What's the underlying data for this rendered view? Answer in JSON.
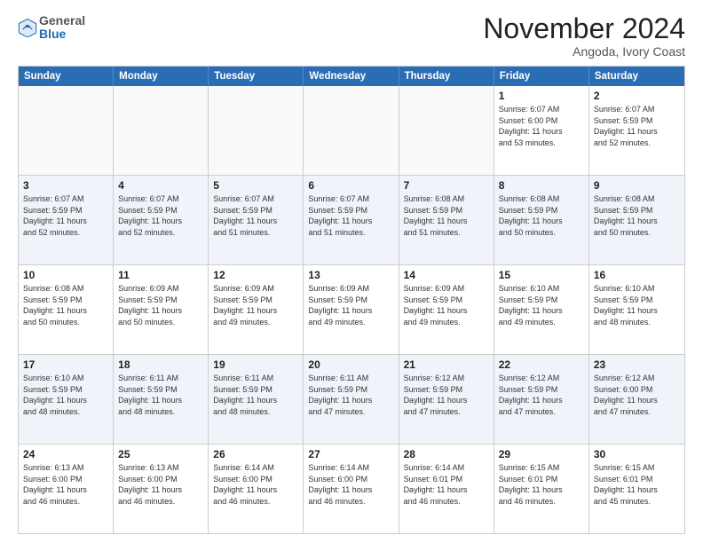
{
  "header": {
    "logo_general": "General",
    "logo_blue": "Blue",
    "month_title": "November 2024",
    "location": "Angoda, Ivory Coast"
  },
  "weekdays": [
    "Sunday",
    "Monday",
    "Tuesday",
    "Wednesday",
    "Thursday",
    "Friday",
    "Saturday"
  ],
  "rows": [
    {
      "alt": false,
      "cells": [
        {
          "empty": true,
          "day": "",
          "info": ""
        },
        {
          "empty": true,
          "day": "",
          "info": ""
        },
        {
          "empty": true,
          "day": "",
          "info": ""
        },
        {
          "empty": true,
          "day": "",
          "info": ""
        },
        {
          "empty": true,
          "day": "",
          "info": ""
        },
        {
          "empty": false,
          "day": "1",
          "info": "Sunrise: 6:07 AM\nSunset: 6:00 PM\nDaylight: 11 hours\nand 53 minutes."
        },
        {
          "empty": false,
          "day": "2",
          "info": "Sunrise: 6:07 AM\nSunset: 5:59 PM\nDaylight: 11 hours\nand 52 minutes."
        }
      ]
    },
    {
      "alt": true,
      "cells": [
        {
          "empty": false,
          "day": "3",
          "info": "Sunrise: 6:07 AM\nSunset: 5:59 PM\nDaylight: 11 hours\nand 52 minutes."
        },
        {
          "empty": false,
          "day": "4",
          "info": "Sunrise: 6:07 AM\nSunset: 5:59 PM\nDaylight: 11 hours\nand 52 minutes."
        },
        {
          "empty": false,
          "day": "5",
          "info": "Sunrise: 6:07 AM\nSunset: 5:59 PM\nDaylight: 11 hours\nand 51 minutes."
        },
        {
          "empty": false,
          "day": "6",
          "info": "Sunrise: 6:07 AM\nSunset: 5:59 PM\nDaylight: 11 hours\nand 51 minutes."
        },
        {
          "empty": false,
          "day": "7",
          "info": "Sunrise: 6:08 AM\nSunset: 5:59 PM\nDaylight: 11 hours\nand 51 minutes."
        },
        {
          "empty": false,
          "day": "8",
          "info": "Sunrise: 6:08 AM\nSunset: 5:59 PM\nDaylight: 11 hours\nand 50 minutes."
        },
        {
          "empty": false,
          "day": "9",
          "info": "Sunrise: 6:08 AM\nSunset: 5:59 PM\nDaylight: 11 hours\nand 50 minutes."
        }
      ]
    },
    {
      "alt": false,
      "cells": [
        {
          "empty": false,
          "day": "10",
          "info": "Sunrise: 6:08 AM\nSunset: 5:59 PM\nDaylight: 11 hours\nand 50 minutes."
        },
        {
          "empty": false,
          "day": "11",
          "info": "Sunrise: 6:09 AM\nSunset: 5:59 PM\nDaylight: 11 hours\nand 50 minutes."
        },
        {
          "empty": false,
          "day": "12",
          "info": "Sunrise: 6:09 AM\nSunset: 5:59 PM\nDaylight: 11 hours\nand 49 minutes."
        },
        {
          "empty": false,
          "day": "13",
          "info": "Sunrise: 6:09 AM\nSunset: 5:59 PM\nDaylight: 11 hours\nand 49 minutes."
        },
        {
          "empty": false,
          "day": "14",
          "info": "Sunrise: 6:09 AM\nSunset: 5:59 PM\nDaylight: 11 hours\nand 49 minutes."
        },
        {
          "empty": false,
          "day": "15",
          "info": "Sunrise: 6:10 AM\nSunset: 5:59 PM\nDaylight: 11 hours\nand 49 minutes."
        },
        {
          "empty": false,
          "day": "16",
          "info": "Sunrise: 6:10 AM\nSunset: 5:59 PM\nDaylight: 11 hours\nand 48 minutes."
        }
      ]
    },
    {
      "alt": true,
      "cells": [
        {
          "empty": false,
          "day": "17",
          "info": "Sunrise: 6:10 AM\nSunset: 5:59 PM\nDaylight: 11 hours\nand 48 minutes."
        },
        {
          "empty": false,
          "day": "18",
          "info": "Sunrise: 6:11 AM\nSunset: 5:59 PM\nDaylight: 11 hours\nand 48 minutes."
        },
        {
          "empty": false,
          "day": "19",
          "info": "Sunrise: 6:11 AM\nSunset: 5:59 PM\nDaylight: 11 hours\nand 48 minutes."
        },
        {
          "empty": false,
          "day": "20",
          "info": "Sunrise: 6:11 AM\nSunset: 5:59 PM\nDaylight: 11 hours\nand 47 minutes."
        },
        {
          "empty": false,
          "day": "21",
          "info": "Sunrise: 6:12 AM\nSunset: 5:59 PM\nDaylight: 11 hours\nand 47 minutes."
        },
        {
          "empty": false,
          "day": "22",
          "info": "Sunrise: 6:12 AM\nSunset: 5:59 PM\nDaylight: 11 hours\nand 47 minutes."
        },
        {
          "empty": false,
          "day": "23",
          "info": "Sunrise: 6:12 AM\nSunset: 6:00 PM\nDaylight: 11 hours\nand 47 minutes."
        }
      ]
    },
    {
      "alt": false,
      "cells": [
        {
          "empty": false,
          "day": "24",
          "info": "Sunrise: 6:13 AM\nSunset: 6:00 PM\nDaylight: 11 hours\nand 46 minutes."
        },
        {
          "empty": false,
          "day": "25",
          "info": "Sunrise: 6:13 AM\nSunset: 6:00 PM\nDaylight: 11 hours\nand 46 minutes."
        },
        {
          "empty": false,
          "day": "26",
          "info": "Sunrise: 6:14 AM\nSunset: 6:00 PM\nDaylight: 11 hours\nand 46 minutes."
        },
        {
          "empty": false,
          "day": "27",
          "info": "Sunrise: 6:14 AM\nSunset: 6:00 PM\nDaylight: 11 hours\nand 46 minutes."
        },
        {
          "empty": false,
          "day": "28",
          "info": "Sunrise: 6:14 AM\nSunset: 6:01 PM\nDaylight: 11 hours\nand 46 minutes."
        },
        {
          "empty": false,
          "day": "29",
          "info": "Sunrise: 6:15 AM\nSunset: 6:01 PM\nDaylight: 11 hours\nand 46 minutes."
        },
        {
          "empty": false,
          "day": "30",
          "info": "Sunrise: 6:15 AM\nSunset: 6:01 PM\nDaylight: 11 hours\nand 45 minutes."
        }
      ]
    }
  ]
}
